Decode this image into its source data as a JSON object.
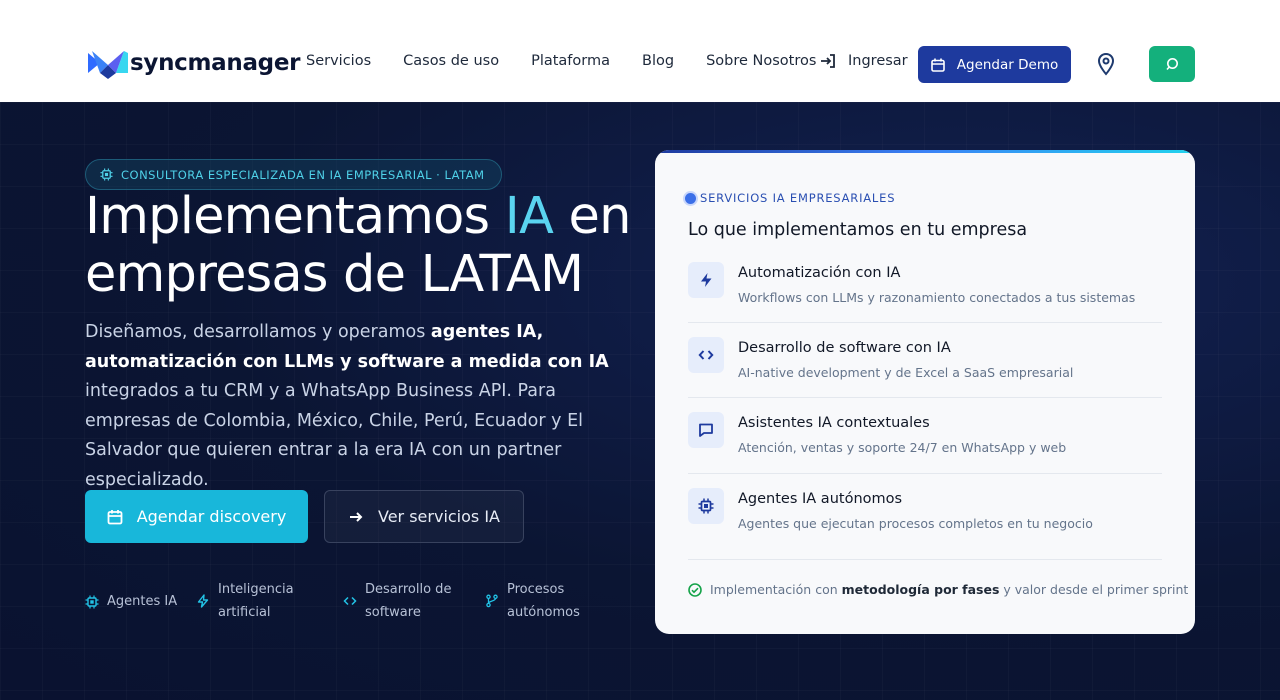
{
  "brand": {
    "name": "syncmanager",
    "colors": {
      "primary": "#1e3a9e",
      "accent": "#18b7da",
      "whatsapp": "#14b07c"
    }
  },
  "nav": {
    "items": [
      "Servicios",
      "Casos de uso",
      "Plataforma",
      "Blog",
      "Sobre Nosotros"
    ],
    "login_label": "Ingresar",
    "demo_label": "Agendar Demo"
  },
  "hero": {
    "badge": "CONSULTORA ESPECIALIZADA EN IA EMPRESARIAL · LATAM",
    "headline_part1": "Implementamos ",
    "headline_accent": "IA",
    "headline_part2": " en empresas de LATAM",
    "desc_part1": "Diseñamos, desarrollamos y operamos ",
    "desc_bold": "agentes IA, automatización con LLMs y software a medida con IA",
    "desc_part2": " integrados a tu CRM y a WhatsApp Business API. Para empresas de Colombia, México, Chile, Perú, Ecuador y El Salvador que quieren entrar a la era IA con un partner especializado.",
    "cta_primary": "Agendar discovery",
    "cta_secondary": "Ver servicios IA",
    "features": [
      {
        "icon": "chip-icon",
        "label": "Agentes IA"
      },
      {
        "icon": "bolt-icon",
        "label": "Inteligencia artificial"
      },
      {
        "icon": "code-icon",
        "label": "Desarrollo de software"
      },
      {
        "icon": "branch-icon",
        "label": "Procesos autónomos"
      }
    ]
  },
  "card": {
    "label": "SERVICIOS IA EMPRESARIALES",
    "title": "Lo que implementamos en tu empresa",
    "services": [
      {
        "icon": "bolt-icon",
        "name": "Automatización con IA",
        "desc": "Workflows con LLMs y razonamiento conectados a tus sistemas"
      },
      {
        "icon": "code-icon",
        "name": "Desarrollo de software con IA",
        "desc": "AI-native development y de Excel a SaaS empresarial"
      },
      {
        "icon": "chat-icon",
        "name": "Asistentes IA contextuales",
        "desc": "Atención, ventas y soporte 24/7 en WhatsApp y web"
      },
      {
        "icon": "chip-icon",
        "name": "Agentes IA autónomos",
        "desc": "Agentes que ejecutan procesos completos en tu negocio"
      }
    ],
    "footer_part1": "Implementación con ",
    "footer_bold": "metodología por fases",
    "footer_part2": " y valor desde el primer sprint"
  }
}
